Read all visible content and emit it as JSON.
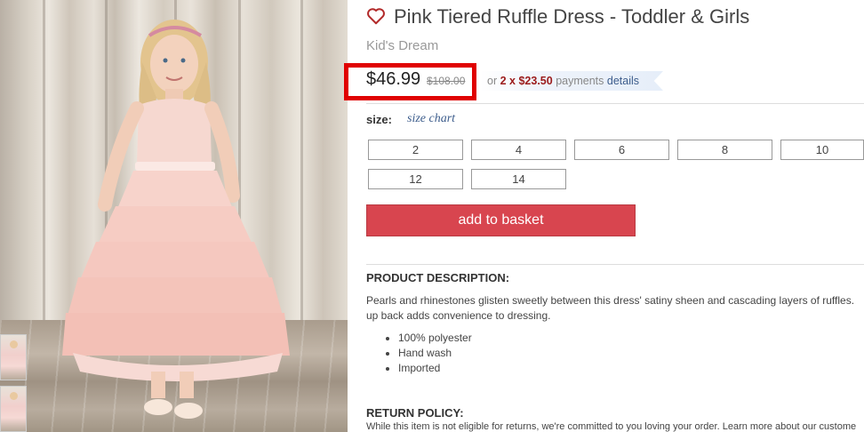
{
  "product": {
    "title": "Pink Tiered Ruffle Dress - Toddler & Girls",
    "brand": "Kid's Dream",
    "heart_icon": "heart-outline-icon",
    "accent_color": "#d8454f"
  },
  "price": {
    "current": "$46.99",
    "original": "$108.00",
    "payment_prefix": "or",
    "payment_amount": "2 x $23.50",
    "payment_word": "payments",
    "payment_link": "details",
    "highlight_color": "#e00000"
  },
  "size": {
    "label": "size:",
    "chart_link": "size chart",
    "options": [
      "2",
      "4",
      "6",
      "8",
      "10",
      "12",
      "14"
    ]
  },
  "actions": {
    "add_to_basket": "add to basket"
  },
  "description": {
    "heading": "PRODUCT DESCRIPTION:",
    "line1": "Pearls and rhinestones glisten sweetly between this dress' satiny sheen and cascading layers of ruffles.",
    "line2": "up back adds convenience to dressing.",
    "bullets": [
      "100% polyester",
      "Hand wash",
      "Imported"
    ]
  },
  "return_policy": {
    "heading": "RETURN POLICY:",
    "text": "While this item is not eligible for returns, we're committed to you loving your order. Learn more about our custome"
  }
}
